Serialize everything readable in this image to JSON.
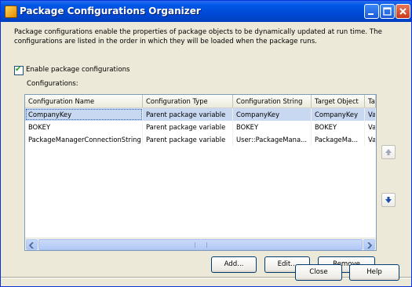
{
  "window": {
    "title": "Package Configurations Organizer",
    "description": "Package configurations enable the properties of package objects to be dynamically updated at run time. The configurations are listed in the order in which they will be loaded when the package runs."
  },
  "enable_checkbox": {
    "label": "Enable package configurations",
    "checked": true
  },
  "configurations_label": "Configurations:",
  "table": {
    "columns": [
      "Configuration Name",
      "Configuration Type",
      "Configuration String",
      "Target Object",
      "Ta"
    ],
    "rows": [
      {
        "cells": [
          "CompanyKey",
          "Parent package variable",
          "CompanyKey",
          "CompanyKey",
          "Va"
        ],
        "selected": true
      },
      {
        "cells": [
          "BOKEY",
          "Parent package variable",
          "BOKEY",
          "BOKEY",
          "Va"
        ],
        "selected": false
      },
      {
        "cells": [
          "PackageManagerConnectionString",
          "Parent package variable",
          "User::PackageMana...",
          "PackageMa...",
          "Va"
        ],
        "selected": false
      }
    ]
  },
  "buttons": {
    "add": "Add...",
    "edit": "Edit...",
    "remove": "Remove",
    "close": "Close",
    "help": "Help"
  },
  "icons": {
    "app": "package-icon",
    "minimize": "minimize-icon",
    "maximize": "maximize-icon",
    "close": "close-icon",
    "move_up": "arrow-up-icon",
    "move_down": "arrow-down-icon"
  },
  "colors": {
    "titlebar": "#0054e3",
    "selection": "#c8d8f0",
    "dialog_bg": "#ece9d8"
  }
}
